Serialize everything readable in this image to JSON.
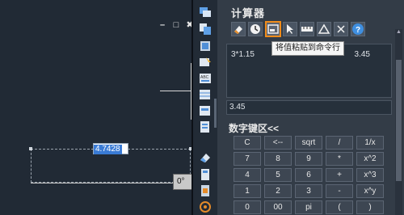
{
  "window_controls": [
    "–",
    "□",
    "✖"
  ],
  "drawing": {
    "dimension_value": "4.7428",
    "angle_value": "0°"
  },
  "calculator": {
    "title": "计算器",
    "toolbar_tooltip": "将值粘贴到命令行",
    "toolbar_icons": [
      "clear-icon",
      "history-icon",
      "paste-to-command-line-icon",
      "pick-point-icon",
      "measure-distance-icon",
      "angle-icon",
      "close-calc-icon",
      "help-icon"
    ],
    "history": [
      {
        "expression": "3*1.15",
        "result": "3.45"
      }
    ],
    "input_value": "3.45",
    "keypad_title": "数字键区<<",
    "keys": [
      [
        "C",
        "<--",
        "sqrt",
        "/",
        "1/x"
      ],
      [
        "7",
        "8",
        "9",
        "*",
        "x^2"
      ],
      [
        "4",
        "5",
        "6",
        "+",
        "x^3"
      ],
      [
        "1",
        "2",
        "3",
        "-",
        "x^y"
      ],
      [
        "0",
        "00",
        "pi",
        "(",
        ")"
      ]
    ]
  },
  "colors": {
    "canvas_bg": "#212a35",
    "panel_bg": "#333c47",
    "active_border": "#f08c1a",
    "selection_blue": "#3a7bd5"
  }
}
